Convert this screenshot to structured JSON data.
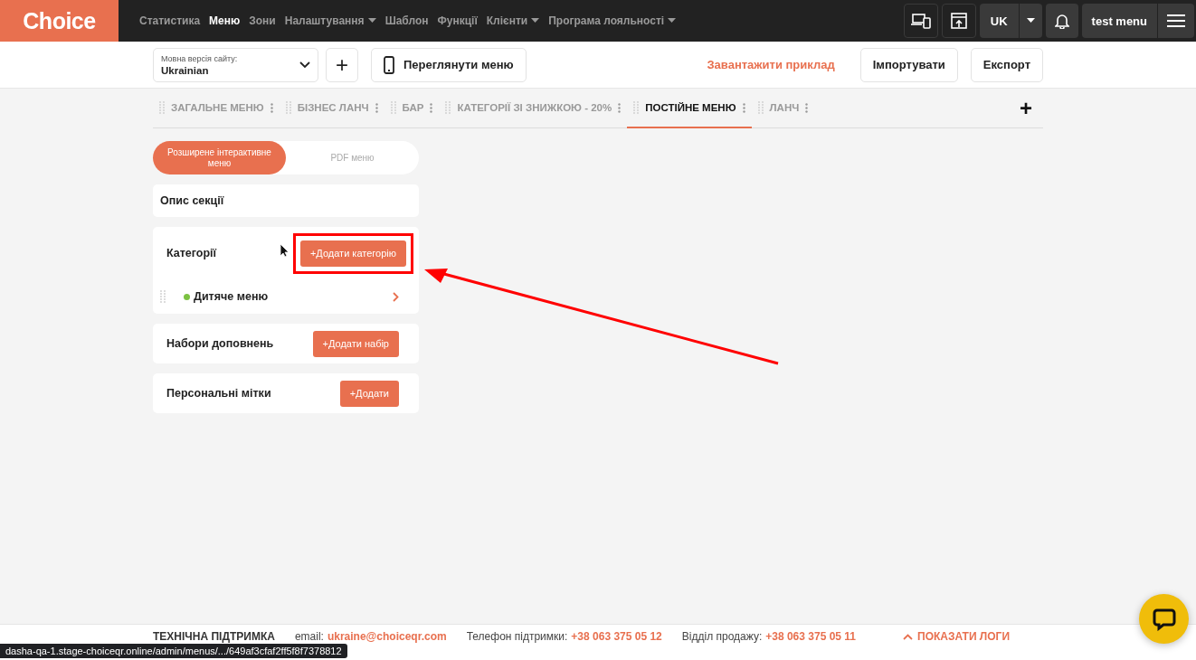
{
  "logo": "Choice",
  "nav": [
    {
      "label": "Статистика",
      "selected": false,
      "dropdown": false
    },
    {
      "label": "Меню",
      "selected": true,
      "dropdown": false
    },
    {
      "label": "Зони",
      "selected": false,
      "dropdown": false
    },
    {
      "label": "Налаштування",
      "selected": false,
      "dropdown": true
    },
    {
      "label": "Шаблон",
      "selected": false,
      "dropdown": false
    },
    {
      "label": "Функції",
      "selected": false,
      "dropdown": false
    },
    {
      "label": "Клієнти",
      "selected": false,
      "dropdown": true
    },
    {
      "label": "Програма лояльності",
      "selected": false,
      "dropdown": true
    }
  ],
  "header_right": {
    "language": "UK",
    "account": "test menu"
  },
  "toolbar": {
    "language_select": {
      "label": "Мовна версія сайту:",
      "value": "Ukrainian"
    },
    "add": "+",
    "preview": "Переглянути меню",
    "download_example": "Завантажити приклад",
    "import": "Імпортувати",
    "export": "Експорт"
  },
  "menu_tabs": [
    {
      "label": "ЗАГАЛЬНЕ МЕНЮ",
      "selected": false
    },
    {
      "label": "БІЗНЕС ЛАНЧ",
      "selected": false
    },
    {
      "label": "БАР",
      "selected": false
    },
    {
      "label": "КАТЕГОРІЇ ЗІ ЗНИЖКОЮ - 20%",
      "selected": false
    },
    {
      "label": "ПОСТІЙНЕ МЕНЮ",
      "selected": true
    },
    {
      "label": "ЛАНЧ",
      "selected": false
    }
  ],
  "add_tab": "+",
  "view_toggle": [
    {
      "label": "Розширене інтерактивне меню",
      "selected": true
    },
    {
      "label": "PDF меню",
      "selected": false
    }
  ],
  "section_description": "Опис секції",
  "categories": {
    "title": "Категорії",
    "button": "+Додати категорію",
    "highlighted": true,
    "items": [
      {
        "name": "Дитяче меню",
        "color": "#7cc242"
      }
    ]
  },
  "addon_sets": {
    "title": "Набори доповнень",
    "button": "+Додати набір"
  },
  "personal_tags": {
    "title": "Персональні мітки",
    "button": "+Додати"
  },
  "footer": {
    "title": "ТЕХНІЧНА ПІДТРИМКА",
    "email_label": "email:",
    "email": "ukraine@choiceqr.com",
    "phone_label": "Телефон підтримки:",
    "phone": "+38 063 375 05 12",
    "sales_label": "Відділ продажу:",
    "sales_phone": "+38 063 375 05 11",
    "logs": "ПОКАЗАТИ ЛОГИ"
  },
  "status_url": "dasha-qa-1.stage-choiceqr.online/admin/menus/.../649af3cfaf2ff5f8f7378812"
}
